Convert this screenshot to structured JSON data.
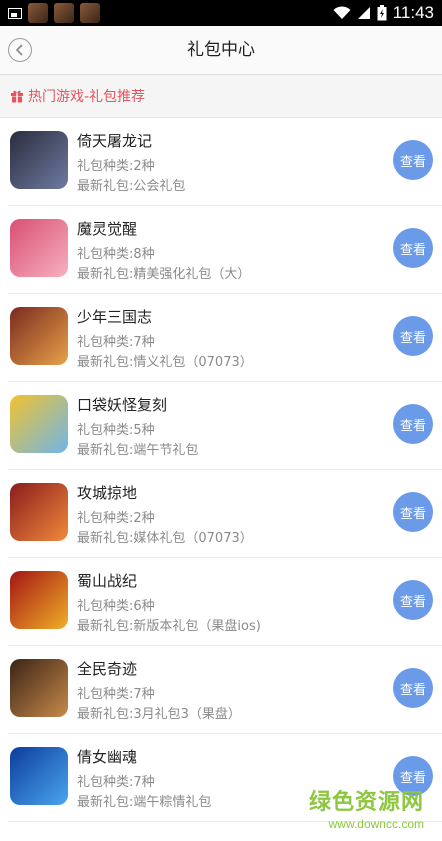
{
  "status_bar": {
    "time": "11:43"
  },
  "header": {
    "title": "礼包中心"
  },
  "section": {
    "title": "热门游戏-礼包推荐"
  },
  "games": [
    {
      "name": "倚天屠龙记",
      "types": "礼包种类:2种",
      "latest": "最新礼包:公会礼包",
      "button": "查看",
      "colors": [
        "#2a2d3e",
        "#6e7aa0"
      ]
    },
    {
      "name": "魔灵觉醒",
      "types": "礼包种类:8种",
      "latest": "最新礼包:精美强化礼包（大）",
      "button": "查看",
      "colors": [
        "#d94f73",
        "#f7b0c0"
      ]
    },
    {
      "name": "少年三国志",
      "types": "礼包种类:7种",
      "latest": "最新礼包:情义礼包（07073）",
      "button": "查看",
      "colors": [
        "#7a2a1e",
        "#e8a24a"
      ]
    },
    {
      "name": "口袋妖怪复刻",
      "types": "礼包种类:5种",
      "latest": "最新礼包:端午节礼包",
      "button": "查看",
      "colors": [
        "#f2c230",
        "#6db6e8"
      ]
    },
    {
      "name": "攻城掠地",
      "types": "礼包种类:2种",
      "latest": "最新礼包:媒体礼包（07073）",
      "button": "查看",
      "colors": [
        "#8a1c1c",
        "#f08a3c"
      ]
    },
    {
      "name": "蜀山战纪",
      "types": "礼包种类:6种",
      "latest": "最新礼包:新版本礼包（果盘ios)",
      "button": "查看",
      "colors": [
        "#a41414",
        "#f0b028"
      ]
    },
    {
      "name": "全民奇迹",
      "types": "礼包种类:7种",
      "latest": "最新礼包:3月礼包3（果盘）",
      "button": "查看",
      "colors": [
        "#3a2416",
        "#c88a4a"
      ]
    },
    {
      "name": "倩女幽魂",
      "types": "礼包种类:7种",
      "latest": "最新礼包:端午粽情礼包",
      "button": "查看",
      "colors": [
        "#0c3c9c",
        "#4aa6f0"
      ]
    }
  ],
  "watermark": {
    "main": "绿色资源网",
    "sub": "www.downcc.com"
  }
}
